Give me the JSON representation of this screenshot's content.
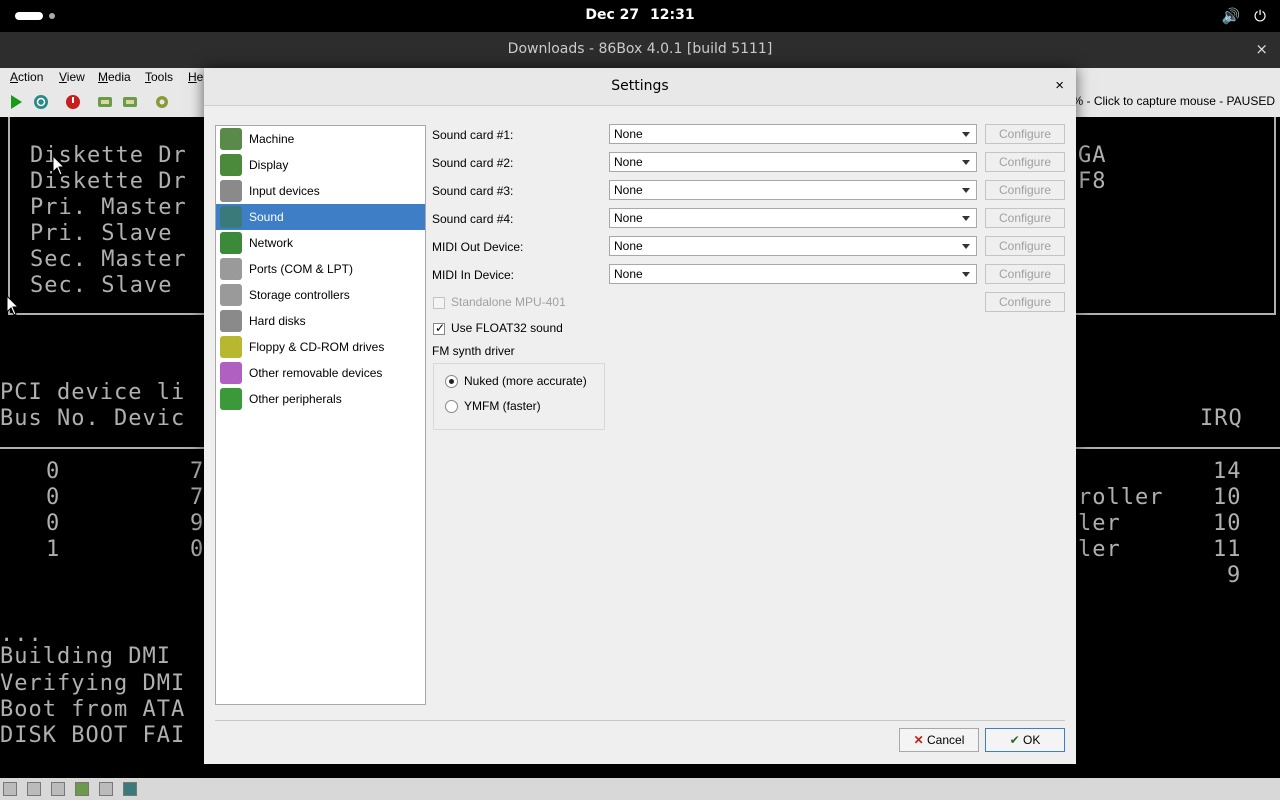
{
  "topbar": {
    "date": "Dec 27",
    "time": "12:31"
  },
  "window": {
    "title": "Downloads - 86Box 4.0.1 [build 5111]",
    "close": "×"
  },
  "menu": [
    "Action",
    "View",
    "Media",
    "Tools",
    "He"
  ],
  "status_right": "% - Click to capture mouse - PAUSED",
  "dos_screen": {
    "left_lines": [
      "Diskette Dr",
      "Diskette Dr",
      "Pri. Master",
      "Pri. Slave ",
      "Sec. Master",
      "Sec. Slave "
    ],
    "right_lines": [
      "GA",
      "F8"
    ],
    "pci_title": "PCI device li",
    "pci_header_left": "Bus No. Devic",
    "pci_header_right": "IRQ",
    "pci_rows": [
      {
        "bus": "0",
        "dev": "7",
        "tail": "",
        "irq": "14"
      },
      {
        "bus": "0",
        "dev": "7",
        "tail": "roller",
        "irq": "10"
      },
      {
        "bus": "0",
        "dev": "9",
        "tail": "ler",
        "irq": "10"
      },
      {
        "bus": "1",
        "dev": "0",
        "tail": "ler",
        "irq": "11"
      },
      {
        "bus": "",
        "dev": "",
        "tail": "",
        "irq": "9"
      }
    ],
    "footer_lines": [
      "...",
      "Building DMI",
      "Verifying DMI",
      "Boot from ATA",
      "DISK BOOT FAI"
    ]
  },
  "dialog": {
    "title": "Settings",
    "close": "×",
    "nav": [
      {
        "label": "Machine",
        "color": "#5a8a4a"
      },
      {
        "label": "Display",
        "color": "#4a8a3a"
      },
      {
        "label": "Input devices",
        "color": "#8a8a8a"
      },
      {
        "label": "Sound",
        "color": "#3a7a7a"
      },
      {
        "label": "Network",
        "color": "#3a8a3a"
      },
      {
        "label": "Ports (COM & LPT)",
        "color": "#9a9a9a"
      },
      {
        "label": "Storage controllers",
        "color": "#9a9a9a"
      },
      {
        "label": "Hard disks",
        "color": "#8a8a8a"
      },
      {
        "label": "Floppy & CD-ROM drives",
        "color": "#b8b830"
      },
      {
        "label": "Other removable devices",
        "color": "#b060c0"
      },
      {
        "label": "Other peripherals",
        "color": "#3a9a3a"
      }
    ],
    "selected_nav": "Sound",
    "rows": [
      {
        "label": "Sound card #1:",
        "value": "None",
        "configure": "Configure"
      },
      {
        "label": "Sound card #2:",
        "value": "None",
        "configure": "Configure"
      },
      {
        "label": "Sound card #3:",
        "value": "None",
        "configure": "Configure"
      },
      {
        "label": "Sound card #4:",
        "value": "None",
        "configure": "Configure"
      },
      {
        "label": "MIDI Out Device:",
        "value": "None",
        "configure": "Configure"
      },
      {
        "label": "MIDI In Device:",
        "value": "None",
        "configure": "Configure"
      }
    ],
    "mpu": {
      "label": "Standalone MPU-401",
      "configure": "Configure",
      "checked": false
    },
    "float32": {
      "label": "Use FLOAT32 sound",
      "checked": true
    },
    "fm_group": {
      "title": "FM synth driver",
      "options": [
        "Nuked (more accurate)",
        "YMFM (faster)"
      ],
      "selected": "Nuked (more accurate)"
    },
    "buttons": {
      "cancel": "Cancel",
      "ok": "OK"
    }
  },
  "colors": {
    "selection": "#3d7ec6",
    "dos_text": "#b0b0b0"
  }
}
